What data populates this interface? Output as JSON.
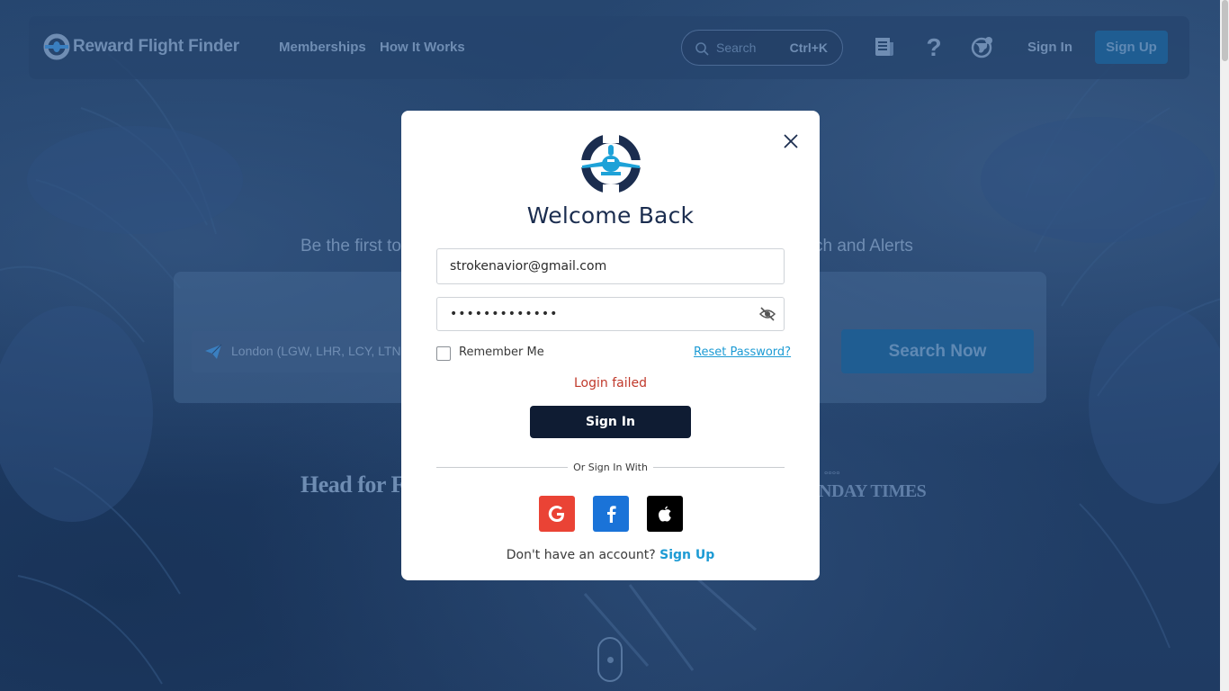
{
  "header": {
    "brand": "Reward Flight Finder",
    "nav": [
      "Memberships",
      "How It Works"
    ],
    "search_placeholder": "Search",
    "search_shortcut": "Ctrl+K",
    "signin_label": "Sign In",
    "signup_label": "Sign Up"
  },
  "hero": {
    "subtitle_left": "Be the first to",
    "subtitle_right": "ch and Alerts",
    "origin_value": "London (LGW, LHR, LCY, LTN,",
    "search_button": "Search Now",
    "press_left": "Head for F",
    "press_right_top": "°°°°",
    "press_right": "NDAY TIMES"
  },
  "modal": {
    "title": "Welcome Back",
    "email_value": "strokenavior@gmail.com",
    "password_value": "•••••••••••••",
    "remember_label": "Remember Me",
    "reset_label": "Reset Password?",
    "error": "Login failed",
    "signin_button": "Sign In",
    "divider": "Or Sign In With",
    "social": [
      "google-icon",
      "facebook-icon",
      "apple-icon"
    ],
    "no_account": "Don't have an account?",
    "signup_link": "Sign Up"
  },
  "colors": {
    "brand_dark": "#0f1c33",
    "accent": "#1d9bd4",
    "error": "#c0392b",
    "google": "#ea4335",
    "facebook": "#1a73d8",
    "apple": "#000000"
  }
}
